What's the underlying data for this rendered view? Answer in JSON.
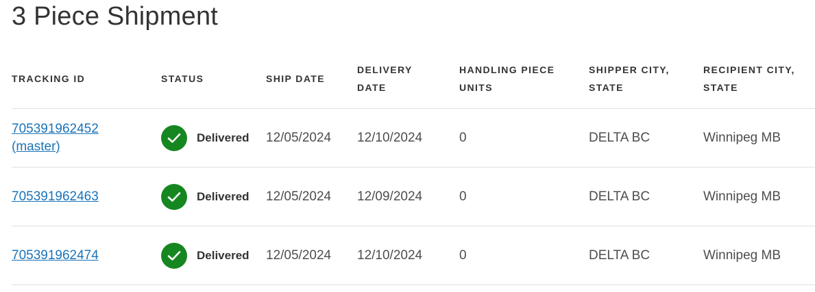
{
  "page": {
    "title": "3 Piece Shipment"
  },
  "table": {
    "headers": {
      "tracking_id": "TRACKING ID",
      "status": "STATUS",
      "ship_date": "SHIP DATE",
      "delivery_date_line1": "DELIVERY",
      "delivery_date_line2": "DATE",
      "handling_line1": "HANDLING PIECE",
      "handling_line2": "UNITS",
      "shipper_line1": "SHIPPER CITY,",
      "shipper_line2": "STATE",
      "recipient_line1": "RECIPIENT CITY,",
      "recipient_line2": "STATE"
    },
    "rows": [
      {
        "tracking_id": "705391962452",
        "tracking_suffix": "(master)",
        "status_icon": "check-circle-icon",
        "status": "Delivered",
        "ship_date": "12/05/2024",
        "delivery_date": "12/10/2024",
        "handling_units": "0",
        "shipper_city_state": "DELTA BC",
        "recipient_city_state": "Winnipeg MB"
      },
      {
        "tracking_id": "705391962463",
        "status_icon": "check-circle-icon",
        "status": "Delivered",
        "ship_date": "12/05/2024",
        "delivery_date": "12/09/2024",
        "handling_units": "0",
        "shipper_city_state": "DELTA BC",
        "recipient_city_state": "Winnipeg MB"
      },
      {
        "tracking_id": "705391962474",
        "status_icon": "check-circle-icon",
        "status": "Delivered",
        "ship_date": "12/05/2024",
        "delivery_date": "12/10/2024",
        "handling_units": "0",
        "shipper_city_state": "DELTA BC",
        "recipient_city_state": "Winnipeg MB"
      }
    ]
  },
  "colors": {
    "link": "#1a73b8",
    "delivered_green": "#168621",
    "divider": "#e0e0e0"
  }
}
